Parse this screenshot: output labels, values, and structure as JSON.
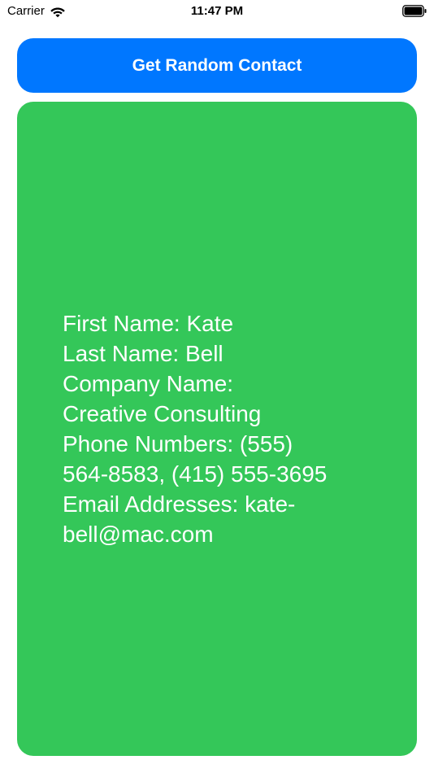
{
  "status_bar": {
    "carrier": "Carrier",
    "time": "11:47 PM",
    "wifi_icon": "wifi-icon",
    "battery_icon": "battery-icon"
  },
  "action": {
    "label": "Get Random Contact",
    "color": "#0077ff"
  },
  "contact": {
    "background": "#34c759",
    "lines": [
      "First Name: Kate",
      "Last Name: Bell",
      "Company Name:",
      "Creative Consulting",
      "Phone Numbers: (555)",
      "564-8583, (415) 555-3695",
      "Email Addresses: kate-",
      "bell@mac.com"
    ]
  }
}
